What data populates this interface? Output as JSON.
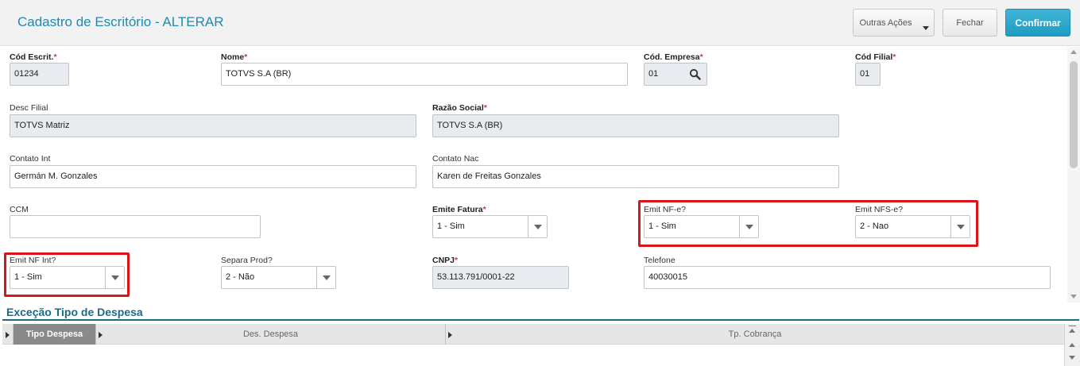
{
  "header": {
    "title": "Cadastro de Escritório - ALTERAR",
    "outras_acoes": "Outras Ações",
    "fechar": "Fechar",
    "confirmar": "Confirmar"
  },
  "required_mark": "*",
  "fields": {
    "cod_escrit": {
      "label": "Cód Escrit.",
      "value": "01234"
    },
    "nome": {
      "label": "Nome",
      "value": "TOTVS S.A (BR)"
    },
    "cod_empresa": {
      "label": "Cód. Empresa",
      "value": "01"
    },
    "cod_filial": {
      "label": "Cód Filial",
      "value": "01"
    },
    "desc_filial": {
      "label": "Desc Filial",
      "value": "TOTVS Matriz"
    },
    "razao_social": {
      "label": "Razão Social",
      "value": "TOTVS S.A (BR)"
    },
    "contato_int": {
      "label": "Contato Int",
      "value": "Germán M. Gonzales"
    },
    "contato_nac": {
      "label": "Contato Nac",
      "value": "Karen de Freitas Gonzales"
    },
    "ccm": {
      "label": "CCM",
      "value": ""
    },
    "emite_fatura": {
      "label": "Emite Fatura",
      "value": "1 - Sim"
    },
    "emit_nfe": {
      "label": "Emit NF-e?",
      "value": "1 - Sim"
    },
    "emit_nfse": {
      "label": "Emit NFS-e?",
      "value": "2 - Nao"
    },
    "emit_nf_int": {
      "label": "Emit NF Int?",
      "value": "1 - Sim"
    },
    "separa_prod": {
      "label": "Separa Prod?",
      "value": "2 - Não"
    },
    "cnpj": {
      "label": "CNPJ",
      "value": "53.113.791/0001-22"
    },
    "telefone": {
      "label": "Telefone",
      "value": "40030015"
    }
  },
  "section": {
    "title": "Exceção Tipo de Despesa",
    "columns": [
      "Tipo Despesa",
      "Des. Despesa",
      "Tp. Cobrança"
    ]
  },
  "colors": {
    "accent": "#1c8bb4",
    "confirm_button": "#1f9cc2",
    "highlight_box": "#d9151c",
    "required": "#e0303a"
  }
}
